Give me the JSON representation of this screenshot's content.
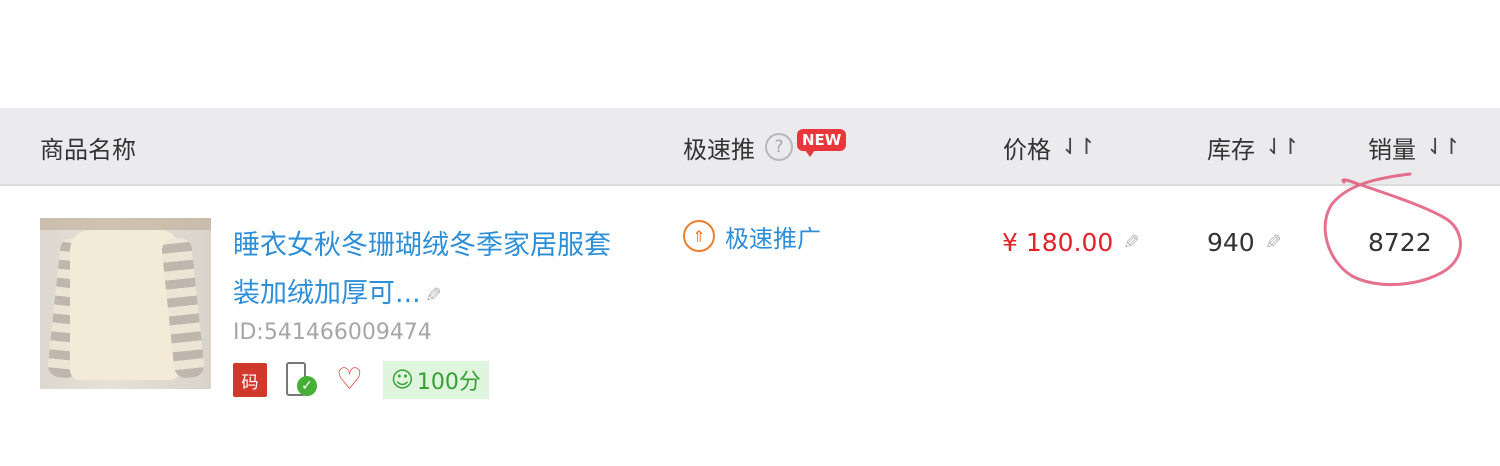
{
  "table": {
    "headers": {
      "name": "商品名称",
      "promo": "极速推",
      "promo_help": "?",
      "promo_new": "NEW",
      "price": "价格",
      "stock": "库存",
      "sales": "销量",
      "sort_glyph": "⇃↾"
    },
    "row": {
      "title": "睡衣女秋冬珊瑚绒冬季家居服套装加绒加厚可...",
      "id_text": "ID:541466009474",
      "badge_ma": "码",
      "score": "100分",
      "promo_link": "极速推广",
      "price": "¥ 180.00",
      "stock": "940",
      "sales": "8722"
    }
  },
  "icons": {
    "sort": "sort-arrows-icon",
    "help": "help-circle-icon",
    "edit": "pencil-icon",
    "phone": "mobile-check-icon",
    "heart": "heart-icon",
    "smile": "smile-icon",
    "rocket": "rocket-icon"
  },
  "colors": {
    "link_blue": "#2e8fd9",
    "price_red": "#e0242a",
    "new_badge_red": "#e8363a",
    "header_bg": "#ebebed",
    "score_bg": "#dff5de",
    "score_green": "#34a232",
    "annotation_pink": "#e0587a"
  }
}
